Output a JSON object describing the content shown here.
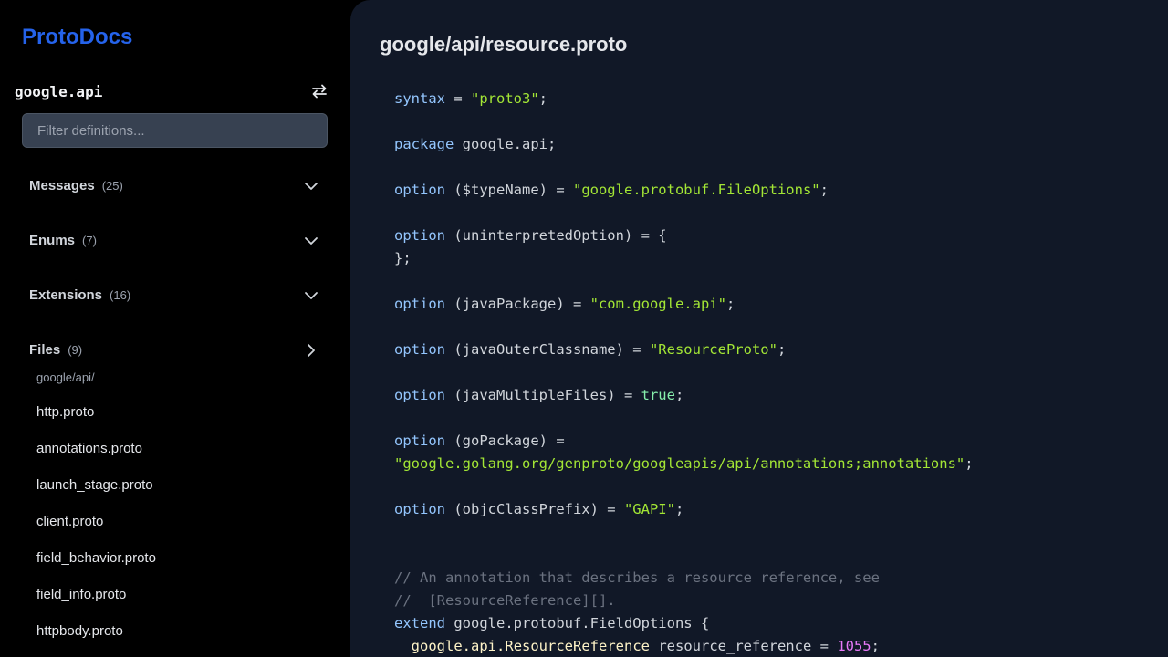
{
  "sidebar": {
    "brand": "ProtoDocs",
    "package": "google.api",
    "filter_placeholder": "Filter definitions...",
    "sections": [
      {
        "label": "Messages",
        "count": "(25)",
        "expanded": false
      },
      {
        "label": "Enums",
        "count": "(7)",
        "expanded": false
      },
      {
        "label": "Extensions",
        "count": "(16)",
        "expanded": false
      },
      {
        "label": "Files",
        "count": "(9)",
        "expanded": true
      }
    ],
    "files_dir": "google/api/",
    "files": [
      "http.proto",
      "annotations.proto",
      "launch_stage.proto",
      "client.proto",
      "field_behavior.proto",
      "field_info.proto",
      "httpbody.proto"
    ]
  },
  "main": {
    "title": "google/api/resource.proto",
    "code": {
      "l1": {
        "kw": "syntax",
        "op": " = ",
        "str": "\"proto3\"",
        "end": ";"
      },
      "l2": {
        "kw": "package",
        "rest": " google.api;"
      },
      "l3": {
        "kw": "option",
        "rest": " ($typeName) = ",
        "str": "\"google.protobuf.FileOptions\"",
        "end": ";"
      },
      "l4": {
        "kw": "option",
        "rest": " (uninterpretedOption) = {"
      },
      "l5": {
        "rest": "};"
      },
      "l6": {
        "kw": "option",
        "rest": " (javaPackage) = ",
        "str": "\"com.google.api\"",
        "end": ";"
      },
      "l7": {
        "kw": "option",
        "rest": " (javaOuterClassname) = ",
        "str": "\"ResourceProto\"",
        "end": ";"
      },
      "l8": {
        "kw": "option",
        "rest": " (javaMultipleFiles) = ",
        "val": "true",
        "end": ";"
      },
      "l9": {
        "kw": "option",
        "rest": " (goPackage) ="
      },
      "l10": {
        "str": "\"google.golang.org/genproto/googleapis/api/annotations;annotations\"",
        "end": ";"
      },
      "l11": {
        "kw": "option",
        "rest": " (objcClassPrefix) = ",
        "str": "\"GAPI\"",
        "end": ";"
      },
      "l12": {
        "cmt": "// An annotation that describes a resource reference, see"
      },
      "l13": {
        "cmt": "//  [ResourceReference][]."
      },
      "l14": {
        "kw": "extend",
        "rest": " google.protobuf.FieldOptions {"
      },
      "l15": {
        "indent": "  ",
        "link1": "google",
        "dot1": ".",
        "link2": "api",
        "dot2": ".",
        "link3": "ResourceReference",
        "rest": " resource_reference = ",
        "num": "1055",
        "end": ";"
      }
    }
  },
  "colors": {
    "brand": "#2563eb",
    "keyword": "#93c5fd",
    "string": "#a3e635",
    "number": "#e879f9",
    "comment": "#6b7280"
  }
}
